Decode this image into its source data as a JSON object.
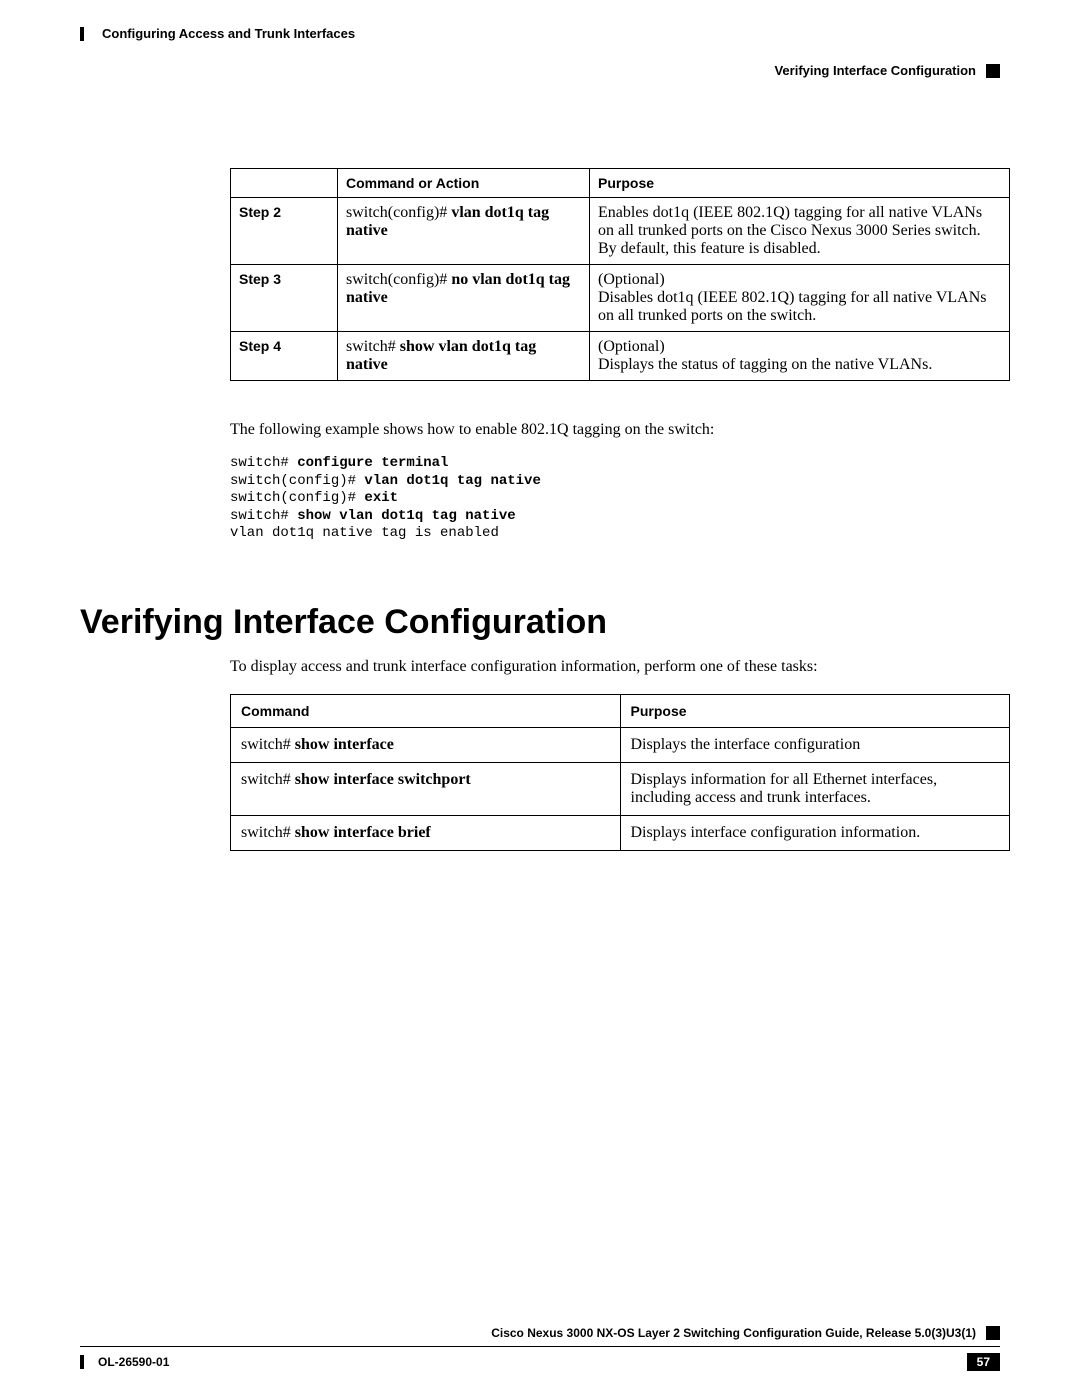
{
  "header": {
    "chapter": "Configuring Access and Trunk Interfaces",
    "section": "Verifying Interface Configuration"
  },
  "stepsTable": {
    "headers": {
      "col1": "",
      "col2": "Command or Action",
      "col3": "Purpose"
    },
    "rows": [
      {
        "step": "Step 2",
        "cmd_prefix": "switch(config)# ",
        "cmd_bold": "vlan dot1q tag native",
        "purpose": "Enables dot1q (IEEE 802.1Q) tagging for all native VLANs on all trunked ports on the Cisco Nexus 3000 Series switch. By default, this feature is disabled."
      },
      {
        "step": "Step 3",
        "cmd_prefix": "switch(config)# ",
        "cmd_bold": "no vlan dot1q tag native",
        "purpose_optional": "(Optional)",
        "purpose_rest": "Disables dot1q (IEEE 802.1Q) tagging for all native VLANs on all trunked ports on the switch."
      },
      {
        "step": "Step 4",
        "cmd_prefix": "switch# ",
        "cmd_bold": "show vlan dot1q tag native",
        "purpose_optional": "(Optional)",
        "purpose_rest": "Displays the status of tagging on the native VLANs."
      }
    ]
  },
  "intro": "The following example shows how to enable 802.1Q tagging on the switch:",
  "cli": {
    "l1a": "switch# ",
    "l1b": "configure terminal",
    "l2a": "switch(config)# ",
    "l2b": "vlan dot1q tag native",
    "l3a": "switch(config)# ",
    "l3b": "exit",
    "l4a": "switch# ",
    "l4b": "show vlan dot1q tag native",
    "l5": "vlan dot1q native tag is enabled"
  },
  "h1": "Verifying Interface Configuration",
  "intro2": "To display access and trunk interface configuration information, perform one of these tasks:",
  "cmdTable": {
    "headers": {
      "col1": "Command",
      "col2": "Purpose"
    },
    "rows": [
      {
        "prefix": "switch# ",
        "bold": "show interface",
        "purpose": "Displays the interface configuration"
      },
      {
        "prefix": "switch# ",
        "bold": "show interface switchport",
        "purpose": "Displays information for all Ethernet interfaces, including access and trunk interfaces."
      },
      {
        "prefix": "switch# ",
        "bold": "show interface brief",
        "purpose": "Displays interface configuration information."
      }
    ]
  },
  "footer": {
    "guide": "Cisco Nexus 3000 NX-OS Layer 2 Switching Configuration Guide, Release 5.0(3)U3(1)",
    "doc": "OL-26590-01",
    "page": "57"
  }
}
